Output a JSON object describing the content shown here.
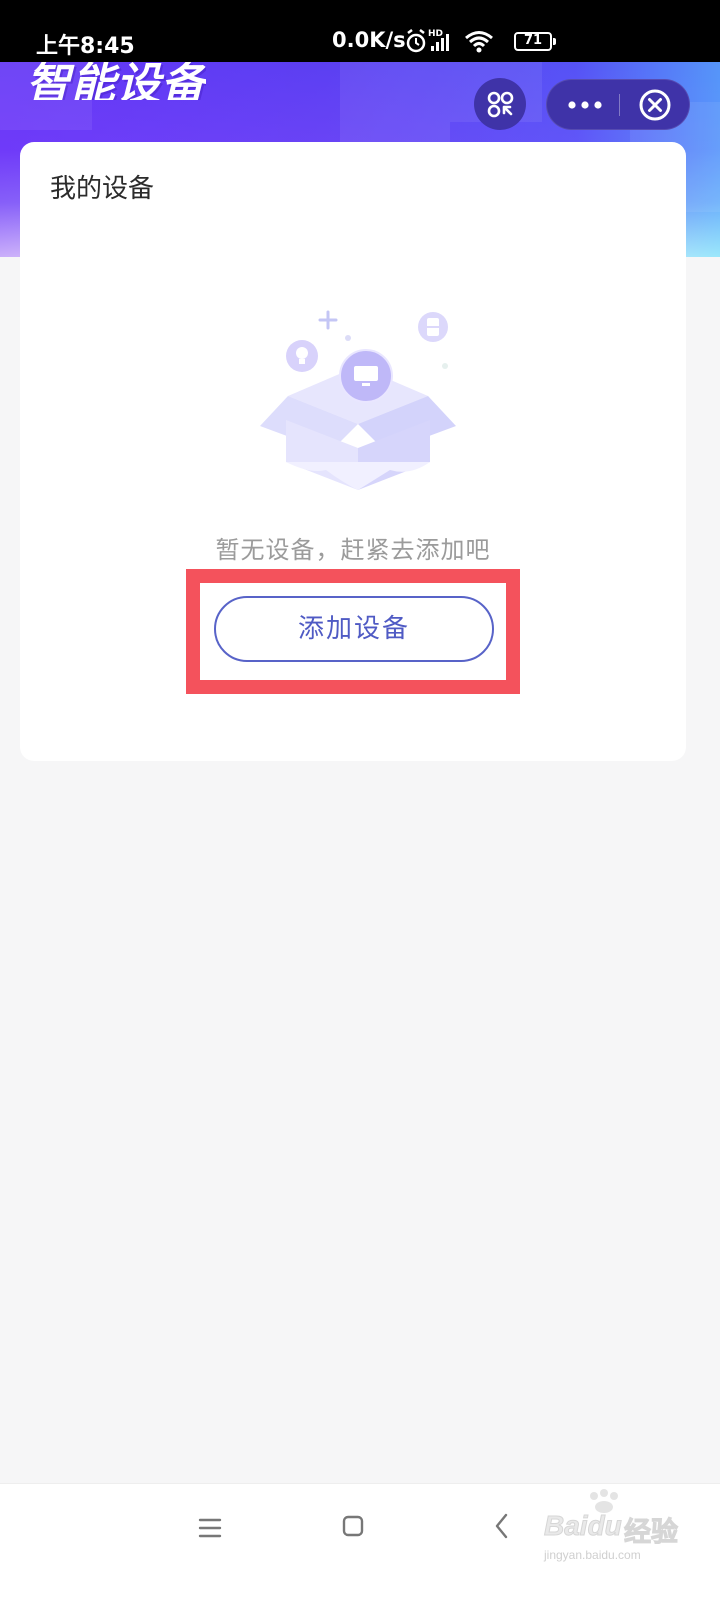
{
  "status_bar": {
    "time": "上午8:45",
    "net_speed": "0.0K/s",
    "network_label": "HD",
    "battery": "71"
  },
  "header": {
    "title": "智能设备"
  },
  "card": {
    "title": "我的设备",
    "empty_message": "暂无设备，赶紧去添加吧",
    "add_button": "添加设备"
  },
  "watermark": {
    "brand": "Baidu",
    "brand_cn": "经验",
    "url": "jingyan.baidu.com"
  },
  "colors": {
    "header_primary": "#5b3ff2",
    "capsule": "#3f33a8",
    "accent_button": "#5863c8",
    "highlight_red": "#f4525c",
    "background": "#f6f6f7"
  },
  "icons": {
    "scan": "scan-icon",
    "more": "more-dots-icon",
    "close": "close-circle-icon",
    "nav_menu": "menu-lines-icon",
    "nav_home": "home-square-icon",
    "nav_back": "back-chevron-icon"
  }
}
